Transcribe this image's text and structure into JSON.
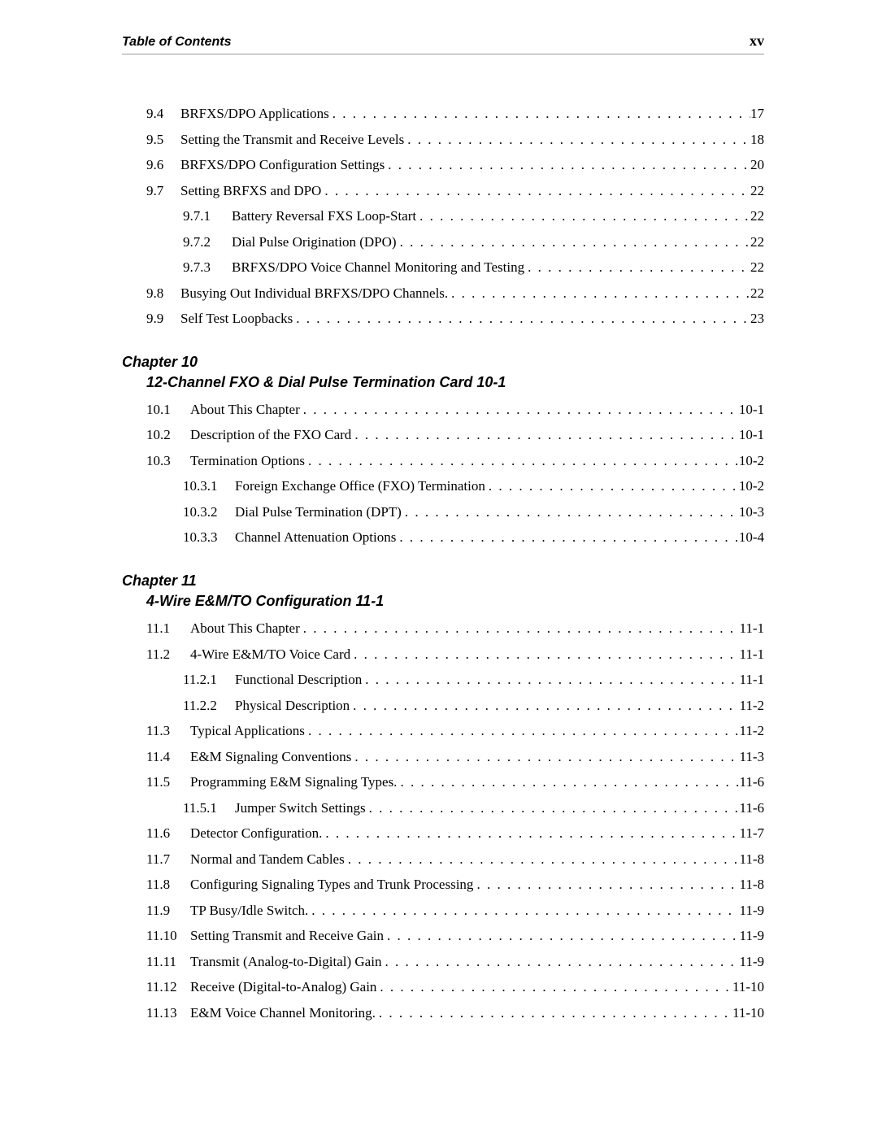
{
  "header": {
    "left": "Table of Contents",
    "right": "xv"
  },
  "blocks": [
    {
      "type": "entries",
      "entries": [
        {
          "level": 1,
          "num": "9.4",
          "text": "BRFXS/DPO Applications",
          "page": "17"
        },
        {
          "level": 1,
          "num": "9.5",
          "text": "Setting the Transmit and Receive Levels",
          "page": "18"
        },
        {
          "level": 1,
          "num": "9.6",
          "text": "BRFXS/DPO Configuration Settings",
          "page": "20"
        },
        {
          "level": 1,
          "num": "9.7",
          "text": "Setting BRFXS and DPO",
          "page": "22"
        },
        {
          "level": 2,
          "num": "9.7.1",
          "text": "Battery Reversal FXS Loop-Start",
          "page": "22"
        },
        {
          "level": 2,
          "num": "9.7.2",
          "text": "Dial Pulse Origination (DPO)",
          "page": "22"
        },
        {
          "level": 2,
          "num": "9.7.3",
          "text": "BRFXS/DPO Voice Channel Monitoring and Testing",
          "page": "22"
        },
        {
          "level": 1,
          "num": "9.8",
          "text": "Busying Out Individual BRFXS/DPO Channels.",
          "page": "22"
        },
        {
          "level": 1,
          "num": "9.9",
          "text": "Self Test Loopbacks",
          "page": "23"
        }
      ]
    },
    {
      "type": "chapter",
      "heading": "Chapter 10",
      "title": "12-Channel FXO & Dial Pulse Termination Card 10-1",
      "entries": [
        {
          "level": 1,
          "num": "10.1",
          "text": "About This Chapter",
          "page": "10-1"
        },
        {
          "level": 1,
          "num": "10.2",
          "text": "Description of the FXO Card",
          "page": "10-1"
        },
        {
          "level": 1,
          "num": "10.3",
          "text": "Termination Options",
          "page": "10-2"
        },
        {
          "level": 2,
          "num": "10.3.1",
          "text": "Foreign Exchange Office (FXO) Termination",
          "page": "10-2"
        },
        {
          "level": 2,
          "num": "10.3.2",
          "text": "Dial Pulse Termination (DPT)",
          "page": "10-3"
        },
        {
          "level": 2,
          "num": "10.3.3",
          "text": "Channel Attenuation Options",
          "page": "10-4"
        }
      ]
    },
    {
      "type": "chapter",
      "heading": "Chapter 11",
      "title": "4-Wire E&M/TO Configuration 11-1",
      "entries": [
        {
          "level": 1,
          "num": "11.1",
          "text": "About This Chapter",
          "page": "11-1"
        },
        {
          "level": 1,
          "num": "11.2",
          "text": "4-Wire E&M/TO Voice Card",
          "page": "11-1"
        },
        {
          "level": 2,
          "num": "11.2.1",
          "text": "Functional Description",
          "page": "11-1"
        },
        {
          "level": 2,
          "num": "11.2.2",
          "text": "Physical Description",
          "page": "11-2"
        },
        {
          "level": 1,
          "num": "11.3",
          "text": "Typical Applications",
          "page": "11-2"
        },
        {
          "level": 1,
          "num": "11.4",
          "text": "E&M Signaling Conventions",
          "page": "11-3"
        },
        {
          "level": 1,
          "num": "11.5",
          "text": "Programming E&M Signaling Types.",
          "page": "11-6"
        },
        {
          "level": 2,
          "num": "11.5.1",
          "text": "Jumper Switch Settings",
          "page": "11-6"
        },
        {
          "level": 1,
          "num": "11.6",
          "text": "Detector Configuration.",
          "page": "11-7"
        },
        {
          "level": 1,
          "num": "11.7",
          "text": "Normal and Tandem Cables",
          "page": "11-8"
        },
        {
          "level": 1,
          "num": "11.8",
          "text": "Configuring Signaling Types and Trunk Processing",
          "page": "11-8"
        },
        {
          "level": 1,
          "num": "11.9",
          "text": "TP Busy/Idle Switch.",
          "page": "11-9"
        },
        {
          "level": 1,
          "num": "11.10",
          "text": "Setting Transmit and Receive Gain",
          "page": "11-9"
        },
        {
          "level": 1,
          "num": "11.11",
          "text": "Transmit (Analog-to-Digital) Gain",
          "page": "11-9"
        },
        {
          "level": 1,
          "num": "11.12",
          "text": "Receive (Digital-to-Analog) Gain",
          "page": "11-10"
        },
        {
          "level": 1,
          "num": "11.13",
          "text": "E&M Voice Channel Monitoring.",
          "page": "11-10"
        }
      ]
    }
  ],
  "dots": ". . . . . . . . . . . . . . . . . . . . . . . . . . . . . . . . . . . . . . . . . . . . . . . . . . . . . . . . . . . . . . . . . . . . . . . ."
}
